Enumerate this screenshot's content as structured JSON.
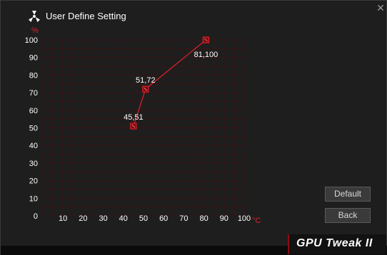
{
  "window": {
    "title": "User Define Setting",
    "close_glyph": "✕",
    "icon": "fan-icon"
  },
  "buttons": {
    "default_label": "Default",
    "back_label": "Back"
  },
  "brand": {
    "text": "GPU Tweak II"
  },
  "colors": {
    "accent": "#e0202a",
    "grid": "#3a1416",
    "curve": "#e0202a"
  },
  "chart_data": {
    "type": "line",
    "xlabel": "°C",
    "ylabel": "%",
    "xlim": [
      0,
      100
    ],
    "ylim": [
      0,
      100
    ],
    "x_ticks": [
      0,
      10,
      20,
      30,
      40,
      50,
      60,
      70,
      80,
      90,
      100
    ],
    "x_tick_labels": [
      "10",
      "20",
      "30",
      "40",
      "50",
      "60",
      "70",
      "80",
      "90",
      "100"
    ],
    "y_tick_labels": [
      "0",
      "10",
      "20",
      "30",
      "40",
      "50",
      "60",
      "70",
      "80",
      "90",
      "100"
    ],
    "y_ticks": [
      0,
      10,
      20,
      30,
      40,
      50,
      60,
      70,
      80,
      90,
      100
    ],
    "grid": true,
    "series": [
      {
        "points": [
          {
            "x": 45,
            "y": 51,
            "label": "45,51"
          },
          {
            "x": 51,
            "y": 72,
            "label": "51,72"
          },
          {
            "x": 81,
            "y": 100,
            "label": "81,100"
          }
        ]
      }
    ]
  }
}
